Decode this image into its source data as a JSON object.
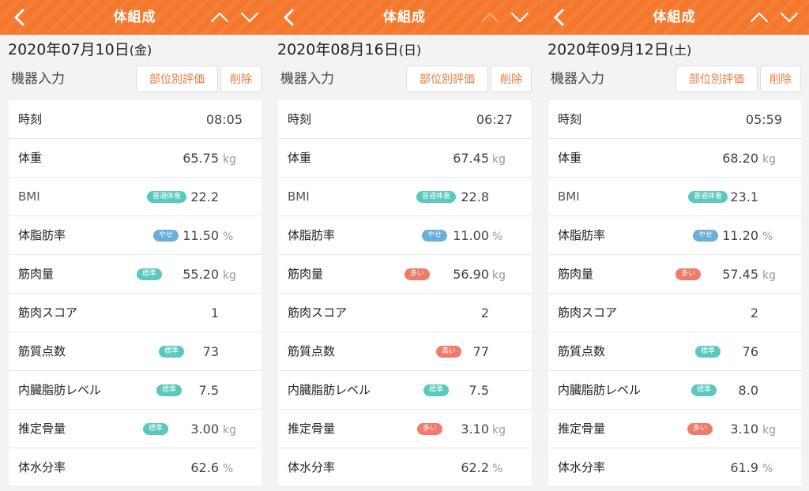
{
  "colors": {
    "header": "#f4772b",
    "button_text": "#ea7a3d",
    "badge_standard": "#5ac8ba",
    "badge_thin": "#6aaedb",
    "badge_high": "#f07b6b"
  },
  "panels": [
    {
      "header": {
        "title": "体組成",
        "back_icon": "chevron-left-icon",
        "up_icon": "chevron-up-icon",
        "down_icon": "chevron-down-icon",
        "up_enabled": true
      },
      "date": {
        "ymd": "2020年07月10日",
        "dow": "(金)"
      },
      "section_label": "機器入力",
      "buttons": {
        "eval": "部位別評価",
        "delete": "削除"
      },
      "rows": {
        "time": {
          "label": "時刻",
          "value": "08:05"
        },
        "weight": {
          "label": "体重",
          "value": "65.75",
          "unit": "kg"
        },
        "bmi": {
          "label": "BMI",
          "badge": "普通体重",
          "value": "22.2"
        },
        "body_fat": {
          "label": "体脂肪率",
          "badge": "やせ",
          "value": "11.50",
          "unit": "%"
        },
        "muscle": {
          "label": "筋肉量",
          "badge": "標準",
          "value": "55.20",
          "unit": "kg"
        },
        "muscle_score": {
          "label": "筋肉スコア",
          "value": "1"
        },
        "muscle_quality": {
          "label": "筋質点数",
          "badge": "標準",
          "value": "73"
        },
        "visceral_fat": {
          "label": "内臓脂肪レベル",
          "badge": "標準",
          "value": "7.5"
        },
        "bone": {
          "label": "推定骨量",
          "badge": "標準",
          "value": "3.00",
          "unit": "kg"
        },
        "water": {
          "label": "体水分率",
          "value": "62.6",
          "unit": "%"
        }
      }
    },
    {
      "header": {
        "title": "体組成",
        "back_icon": "chevron-left-icon",
        "up_icon": "chevron-up-icon",
        "down_icon": "chevron-down-icon",
        "up_enabled": false
      },
      "date": {
        "ymd": "2020年08月16日",
        "dow": "(日)"
      },
      "section_label": "機器入力",
      "buttons": {
        "eval": "部位別評価",
        "delete": "削除"
      },
      "rows": {
        "time": {
          "label": "時刻",
          "value": "06:27"
        },
        "weight": {
          "label": "体重",
          "value": "67.45",
          "unit": "kg"
        },
        "bmi": {
          "label": "BMI",
          "badge": "普通体重",
          "value": "22.8"
        },
        "body_fat": {
          "label": "体脂肪率",
          "badge": "やせ",
          "value": "11.00",
          "unit": "%"
        },
        "muscle": {
          "label": "筋肉量",
          "badge": "多い",
          "value": "56.90",
          "unit": "kg"
        },
        "muscle_score": {
          "label": "筋肉スコア",
          "value": "2"
        },
        "muscle_quality": {
          "label": "筋質点数",
          "badge": "高い",
          "value": "77"
        },
        "visceral_fat": {
          "label": "内臓脂肪レベル",
          "badge": "標準",
          "value": "7.5"
        },
        "bone": {
          "label": "推定骨量",
          "badge": "多い",
          "value": "3.10",
          "unit": "kg"
        },
        "water": {
          "label": "体水分率",
          "value": "62.2",
          "unit": "%"
        }
      }
    },
    {
      "header": {
        "title": "体組成",
        "back_icon": "chevron-left-icon",
        "up_icon": "chevron-up-icon",
        "down_icon": "chevron-down-icon",
        "up_enabled": true
      },
      "date": {
        "ymd": "2020年09月12日",
        "dow": "(土)"
      },
      "section_label": "機器入力",
      "buttons": {
        "eval": "部位別評価",
        "delete": "削除"
      },
      "rows": {
        "time": {
          "label": "時刻",
          "value": "05:59"
        },
        "weight": {
          "label": "体重",
          "value": "68.20",
          "unit": "kg"
        },
        "bmi": {
          "label": "BMI",
          "badge": "普通体重",
          "value": "23.1"
        },
        "body_fat": {
          "label": "体脂肪率",
          "badge": "やせ",
          "value": "11.20",
          "unit": "%"
        },
        "muscle": {
          "label": "筋肉量",
          "badge": "多い",
          "value": "57.45",
          "unit": "kg"
        },
        "muscle_score": {
          "label": "筋肉スコア",
          "value": "2"
        },
        "muscle_quality": {
          "label": "筋質点数",
          "badge": "標準",
          "value": "76"
        },
        "visceral_fat": {
          "label": "内臓脂肪レベル",
          "badge": "標準",
          "value": "8.0"
        },
        "bone": {
          "label": "推定骨量",
          "badge": "多い",
          "value": "3.10",
          "unit": "kg"
        },
        "water": {
          "label": "体水分率",
          "value": "61.9",
          "unit": "%"
        }
      }
    }
  ]
}
